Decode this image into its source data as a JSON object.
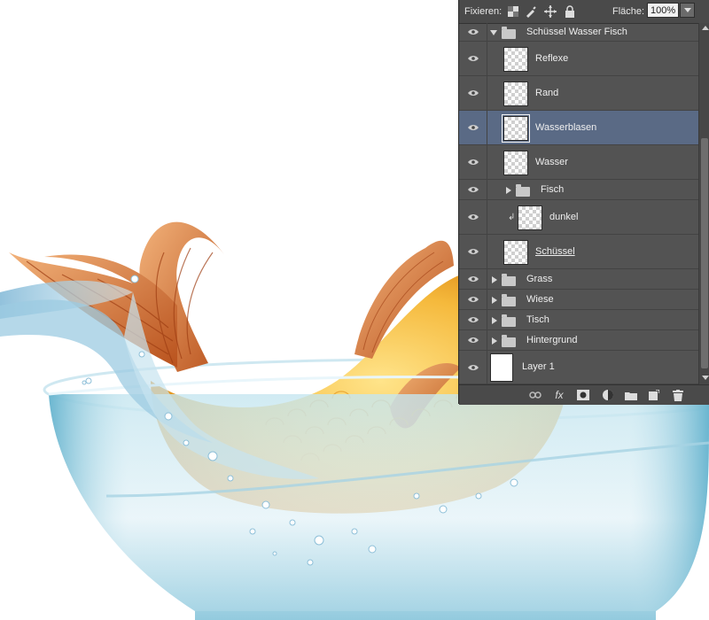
{
  "layers_panel": {
    "lock_label": "Fixieren:",
    "fill_label": "Fläche:",
    "fill_value": "100%",
    "layers": [
      {
        "name": "Schüssel Wasser Fisch",
        "type": "group",
        "expanded": true,
        "depth": 0
      },
      {
        "name": "Reflexe",
        "type": "layer",
        "depth": 1
      },
      {
        "name": "Rand",
        "type": "layer",
        "depth": 1
      },
      {
        "name": "Wasserblasen",
        "type": "layer",
        "depth": 1,
        "selected": true
      },
      {
        "name": "Wasser",
        "type": "layer",
        "depth": 1
      },
      {
        "name": "Fisch",
        "type": "group",
        "expanded": false,
        "depth": 1
      },
      {
        "name": "dunkel",
        "type": "layer",
        "depth": 1,
        "clipped": true
      },
      {
        "name": "Schüssel",
        "type": "layer",
        "depth": 1
      },
      {
        "name": "Grass",
        "type": "group",
        "expanded": false,
        "depth": 0
      },
      {
        "name": "Wiese",
        "type": "group",
        "expanded": false,
        "depth": 0
      },
      {
        "name": "Tisch",
        "type": "group",
        "expanded": false,
        "depth": 0
      },
      {
        "name": "Hintergrund",
        "type": "group",
        "expanded": false,
        "depth": 0
      },
      {
        "name": "Layer 1",
        "type": "layer",
        "depth": 0
      }
    ],
    "footer_icons": [
      "link-icon",
      "fx-icon",
      "mask-icon",
      "adjustment-icon",
      "new-group-icon",
      "new-layer-icon",
      "trash-icon"
    ],
    "fx_label": "fx"
  },
  "colors": {
    "panel_bg": "#535353",
    "selected_row": "#5a6a85",
    "fish_orange": "#f0a224",
    "bowl_blue": "#7cc3da"
  }
}
